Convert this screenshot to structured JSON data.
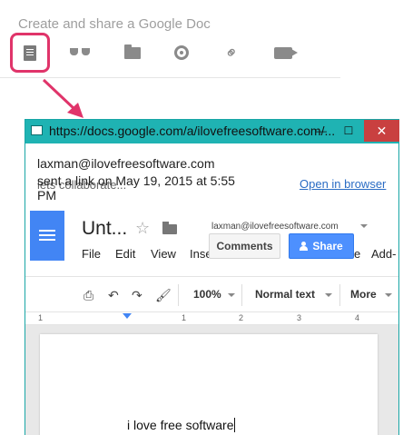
{
  "composer": {
    "title": "Create and share a Google Doc",
    "icons": [
      "document-icon",
      "glasses-icon",
      "folder-icon",
      "location-icon",
      "link-icon",
      "video-icon"
    ]
  },
  "window": {
    "title": "https://docs.google.com/a/ilovefreesoftware.com/...",
    "close_label": "✕",
    "max_label": "☐",
    "min_label": "—"
  },
  "message": {
    "sender": "laxman@ilovefreesoftware.com",
    "sent_text": "sent a link on May 19, 2015 at 5:55 PM",
    "ghost_text": "lets collaborate...",
    "open_link": "Open in browser"
  },
  "docs": {
    "title": "Unt...",
    "account": "laxman@ilovefreesoftware.com",
    "menu": [
      "File",
      "Edit",
      "View",
      "Inse",
      "e",
      "Add-"
    ],
    "comments_label": "Comments",
    "share_label": "Share",
    "zoom": "100%",
    "style": "Normal text",
    "more": "More",
    "ruler_numbers": [
      "1",
      "1",
      "2",
      "3",
      "4"
    ],
    "body_text": "i love free software"
  },
  "colors": {
    "highlight": "#e0346a",
    "titlebar": "#1fb3b3",
    "docs_blue": "#4285f4",
    "share_blue": "#4d90fe"
  }
}
